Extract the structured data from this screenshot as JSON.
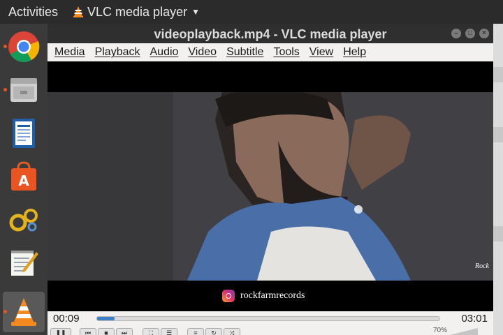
{
  "topbar": {
    "activities": "Activities",
    "app_name": "VLC media player"
  },
  "dock": {
    "items": [
      {
        "name": "chrome-icon",
        "running": true,
        "active": false
      },
      {
        "name": "files-icon",
        "running": true,
        "active": false
      },
      {
        "name": "writer-icon",
        "running": false,
        "active": false
      },
      {
        "name": "software-center-icon",
        "running": false,
        "active": false
      },
      {
        "name": "settings-gears-icon",
        "running": false,
        "active": false
      },
      {
        "name": "text-editor-icon",
        "running": false,
        "active": false
      },
      {
        "name": "vlc-cone-icon",
        "running": true,
        "active": true
      }
    ]
  },
  "window": {
    "title": "videoplayback.mp4 - VLC media player"
  },
  "menu": {
    "items": [
      "Media",
      "Playback",
      "Audio",
      "Video",
      "Subtitle",
      "Tools",
      "View",
      "Help"
    ]
  },
  "video": {
    "instagram_handle": "rockfarmrecords",
    "watermark": "Rock"
  },
  "playback": {
    "elapsed": "00:09",
    "total": "03:01",
    "progress_fraction": 0.05,
    "volume": "70%"
  },
  "colors": {
    "accent": "#3d80c8",
    "ubuntu_orange": "#e95420",
    "titlebar": "#2f2f2f"
  }
}
